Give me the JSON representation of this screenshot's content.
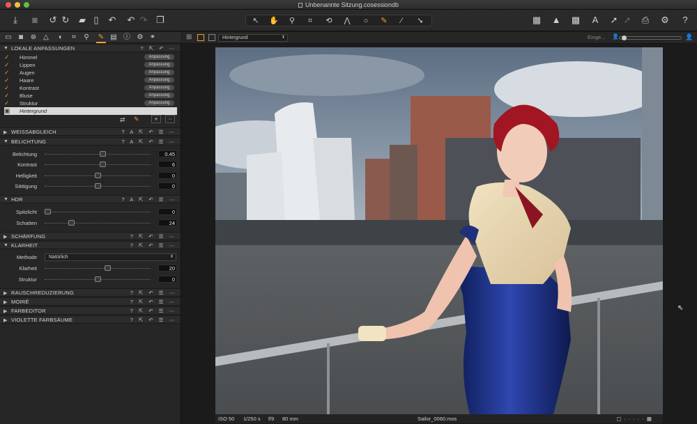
{
  "window": {
    "title": "Unbenannte Sitzung.cosessiondb"
  },
  "toolbar": {
    "left_icons": [
      "import-icon",
      "camera-icon",
      "rotate-left-icon",
      "rotate-right-icon",
      "folder-icon",
      "trash-icon",
      "undo-icon",
      "redo-icon",
      "copy-icon"
    ],
    "center_tools": [
      "cursor-tool",
      "pan-tool",
      "zoom-tool",
      "crop-tool",
      "rotate-tool",
      "keystone-tool",
      "circle-tool",
      "brush-tool",
      "eraser-tool",
      "pick-tool"
    ],
    "right_icons": [
      "grid-icon",
      "warning-icon",
      "exposure-icon",
      "text-icon",
      "arrow-icon",
      "print-icon",
      "gear-icon",
      "help-icon"
    ]
  },
  "left_panel": {
    "local_adjustments": {
      "title": "LOKALE ANPASSUNGEN",
      "layers": [
        {
          "name": "Himmel",
          "badge": "Anpassung"
        },
        {
          "name": "Lippen",
          "badge": "Anpassung"
        },
        {
          "name": "Augen",
          "badge": "Anpassung"
        },
        {
          "name": "Haare",
          "badge": "Anpassung"
        },
        {
          "name": "Kontrast",
          "badge": "Anpassung"
        },
        {
          "name": "Bluse",
          "badge": "Anpassung"
        },
        {
          "name": "Struktur",
          "badge": "Anpassung"
        },
        {
          "name": "Hintergrund",
          "badge": ""
        }
      ]
    },
    "sections": {
      "white_balance": "WEISSABGLEICH",
      "exposure": "BELICHTUNG",
      "hdr": "HDR",
      "sharpening": "SCHÄRFUNG",
      "clarity": "KLARHEIT",
      "noise": "RAUSCHREDUZIERUNG",
      "moire": "MOIRÉ",
      "color_editor": "FARBEDITOR",
      "purple_fringe": "VIOLETTE FARBSÄUME"
    },
    "exposure_sliders": [
      {
        "label": "Belichtung",
        "value": "0.45",
        "level": 0.55
      },
      {
        "label": "Kontrast",
        "value": "6",
        "level": 0.55
      },
      {
        "label": "Helligkeit",
        "value": "0",
        "level": 0.5
      },
      {
        "label": "Sättigung",
        "value": "0",
        "level": 0.5
      }
    ],
    "hdr_sliders": [
      {
        "label": "Spitzlicht",
        "value": "0",
        "level": 0.0
      },
      {
        "label": "Schatten",
        "value": "24",
        "level": 0.24
      }
    ],
    "clarity": {
      "method_label": "Methode",
      "method_value": "Natürlich",
      "sliders": [
        {
          "label": "Klarheit",
          "value": "20",
          "level": 0.6
        },
        {
          "label": "Struktur",
          "value": "0",
          "level": 0.5
        }
      ]
    }
  },
  "viewer": {
    "layer_select": "Hintergrund",
    "right_label": "Einge...",
    "status": {
      "iso": "ISO 50",
      "shutter": "1/250 s",
      "aperture": "f/9",
      "focal": "80 mm",
      "filename": "Sailor_0060.mos"
    }
  }
}
